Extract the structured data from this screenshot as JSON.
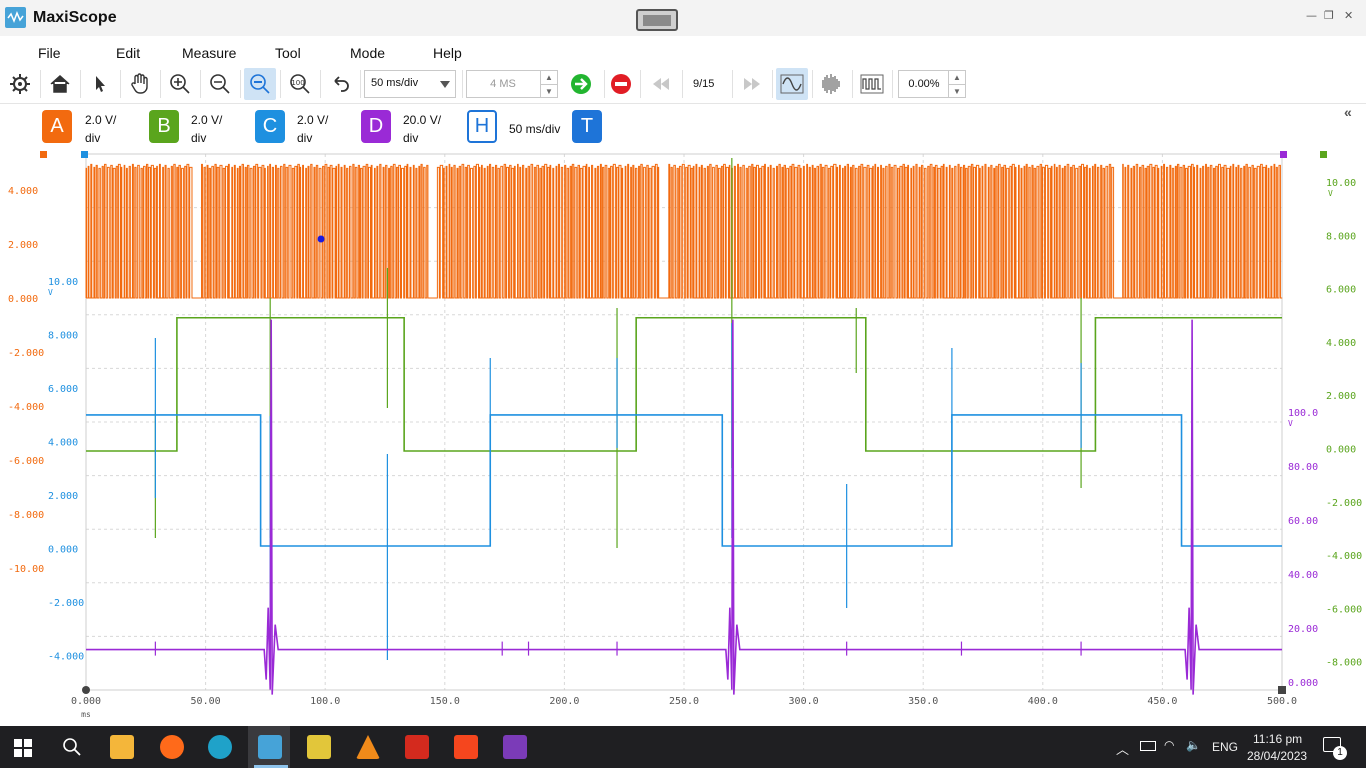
{
  "window": {
    "title": "MaxiScope",
    "controls": {
      "minimize": "—",
      "restore": "❐",
      "close": "✕"
    }
  },
  "menu": [
    "File",
    "Edit",
    "Measure",
    "Tool",
    "Mode",
    "Help"
  ],
  "toolbar": {
    "timebase": "50  ms/div",
    "sample_length": "4 MS",
    "page_counter": "9/15",
    "zoom_percent": "0.00%",
    "icons": [
      "settings-icon",
      "home-icon",
      "pointer-icon",
      "pan-hand-icon",
      "zoom-in-icon",
      "zoom-out-icon",
      "zoom-area-icon",
      "zoom-fit-icon",
      "undo-icon",
      "go-icon",
      "stop-icon",
      "rewind-icon",
      "fast-forward-icon",
      "sine-wave-icon",
      "burst-wave-icon",
      "square-wave-icon"
    ]
  },
  "channels": [
    {
      "id": "A",
      "line1": "2.0 V/",
      "line2": "div",
      "color": "#f26a0f"
    },
    {
      "id": "B",
      "line1": "2.0 V/",
      "line2": "div",
      "color": "#5aa51d"
    },
    {
      "id": "C",
      "line1": "2.0 V/",
      "line2": "div",
      "color": "#1e90e0"
    },
    {
      "id": "D",
      "line1": "20.0 V/",
      "line2": "div",
      "color": "#9a2ad6"
    },
    {
      "id": "H",
      "line1": "50  ms/div",
      "line2": "",
      "color": "#1e74d8"
    },
    {
      "id": "T",
      "line1": "",
      "line2": "",
      "color": "#1e74d8"
    }
  ],
  "chart_data": {
    "type": "line",
    "x_unit": "ms",
    "xlim": [
      0,
      500
    ],
    "x_ticks": [
      "0.000",
      "50.00",
      "100.0",
      "150.0",
      "200.0",
      "250.0",
      "300.0",
      "350.0",
      "400.0",
      "450.0",
      "500.0"
    ],
    "axes": {
      "A": {
        "color": "#f26a0f",
        "ticks": [
          "4.000",
          "2.000",
          "0.000",
          "-2.000",
          "-4.000",
          "-6.000",
          "-8.000",
          "-10.00"
        ]
      },
      "C": {
        "color": "#1e90e0",
        "unit": "V",
        "ticks": [
          "10.00",
          "8.000",
          "6.000",
          "4.000",
          "2.000",
          "0.000",
          "-2.000",
          "-4.000"
        ]
      },
      "D": {
        "color": "#9a2ad6",
        "unit": "V",
        "ticks": [
          "100.0",
          "80.00",
          "60.00",
          "40.00",
          "20.00",
          "0.000"
        ]
      },
      "B": {
        "color": "#5aa51d",
        "unit": "V",
        "ticks": [
          "10.00",
          "8.000",
          "6.000",
          "4.000",
          "2.000",
          "0.000",
          "-2.000",
          "-4.000",
          "-6.000",
          "-8.000"
        ]
      }
    },
    "series": [
      {
        "name": "A",
        "kind": "pwm",
        "high": 4.8,
        "low": 0.0,
        "gaps_ms": [
          44,
          143,
          240,
          430
        ]
      },
      {
        "name": "B",
        "kind": "square",
        "low_v": 0.0,
        "high_v": 5.0,
        "transitions_ms": [
          0,
          38,
          133,
          230,
          326,
          422
        ],
        "start_high": false
      },
      {
        "name": "C",
        "kind": "square",
        "low_v": 0.0,
        "high_v": 4.9,
        "transitions_ms": [
          0,
          73,
          169,
          266,
          362,
          458
        ],
        "start_high": true
      },
      {
        "name": "D",
        "kind": "pulses",
        "base_v": 12.0,
        "spike_ms": [
          77,
          270,
          462
        ]
      }
    ]
  },
  "taskbar": {
    "language": "ENG",
    "time": "11:16 pm",
    "date": "28/04/2023",
    "notifications": "1"
  }
}
